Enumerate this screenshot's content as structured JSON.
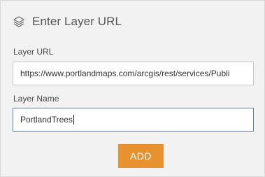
{
  "header": {
    "title": "Enter Layer URL",
    "icon": "layers-icon"
  },
  "form": {
    "url_label": "Layer URL",
    "url_value": "https://www.portlandmaps.com/arcgis/rest/services/Publi",
    "name_label": "Layer Name",
    "name_value": "PortlandTrees"
  },
  "actions": {
    "add_label": "ADD"
  },
  "colors": {
    "accent": "#e8912f",
    "panel_bg": "#f2f2f2",
    "focus_border": "#5b7fa6"
  }
}
